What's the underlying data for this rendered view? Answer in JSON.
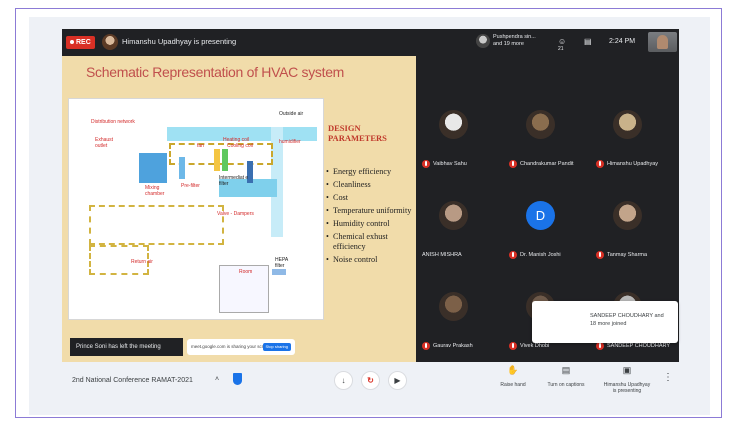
{
  "topbar": {
    "rec_label": "REC",
    "presenting_text": "Himanshu Upadhyay is presenting",
    "participants_summary_line1": "Pushpendra sin...",
    "participants_summary_line2": "and 19 more",
    "people_count": "21",
    "time": "2:24 PM"
  },
  "slide": {
    "title": "Schematic Representation of HVAC system",
    "diagram_labels": {
      "outside_air": "Outside air",
      "distribution_network": "Distribution network",
      "exhaust_outlet": "Exhaust outlet",
      "fan": "fan",
      "heating_coil": "Heating coil",
      "cooling_coil": "Cooling coil",
      "humidifier": "humidifier",
      "mixing_chamber": "Mixing chamber",
      "pre_filter": "Pre-filter",
      "intermediate_filter": "Intermediat e filter",
      "valve_dampers": "Valve - Dampers",
      "return_air": "Return air",
      "room": "Room",
      "hepa_filter": "HEPA filter"
    },
    "design_heading_line1": "DESIGN",
    "design_heading_line2": "PARAMETERS",
    "design_params": [
      "Energy efficiency",
      "Cleanliness",
      "Cost",
      "Temperature uniformity",
      "Humidity control",
      "Chemical exhust efficiency",
      "Noise control"
    ],
    "left_meeting_note": "Prince Soni has left the meeting",
    "share_pill_text": "meet.google.com is sharing your screen",
    "share_stop_label": "Stop sharing"
  },
  "participants": [
    {
      "name": "Vaibhav Sahu",
      "avatar_color": "#e8e8e8",
      "mic": true
    },
    {
      "name": "Chandrakumar Pandit",
      "avatar_color": "#8a6d4e",
      "mic": true
    },
    {
      "name": "Himanshu Upadhyay",
      "avatar_color": "#c9b28a",
      "mic": true
    },
    {
      "name": "ANISH MISHRA",
      "avatar_color": "#b89a84",
      "mic": false
    },
    {
      "name": "Dr. Manish Joshi",
      "avatar_letter": "D",
      "avatar_color": "#1a73e8",
      "mic": true
    },
    {
      "name": "Tanmay Sharma",
      "avatar_color": "#c2a48a",
      "mic": true
    },
    {
      "name": "Gaurav Prakash",
      "avatar_color": "#7c6048",
      "mic": true
    },
    {
      "name": "Vivek Dhobi",
      "avatar_color": "#6f5a4a",
      "mic": true
    },
    {
      "name": "SANDEEP CHOUDHARY",
      "avatar_color": "#b9b9b9",
      "mic": true
    }
  ],
  "toast": {
    "line1": "SANDEEP CHOUDHARY and",
    "line2": "18 more joined"
  },
  "bottombar": {
    "conference_name": "2nd National Conference RAMAT-2021",
    "mic_icon": "mic-icon",
    "end_icon": "end-call-icon",
    "camera_icon": "camera-icon",
    "raise_hand_label": "Raise hand",
    "captions_label": "Turn on captions",
    "presenting_label_line1": "Himanshu Upadhyay",
    "presenting_label_line2": "is presenting"
  }
}
